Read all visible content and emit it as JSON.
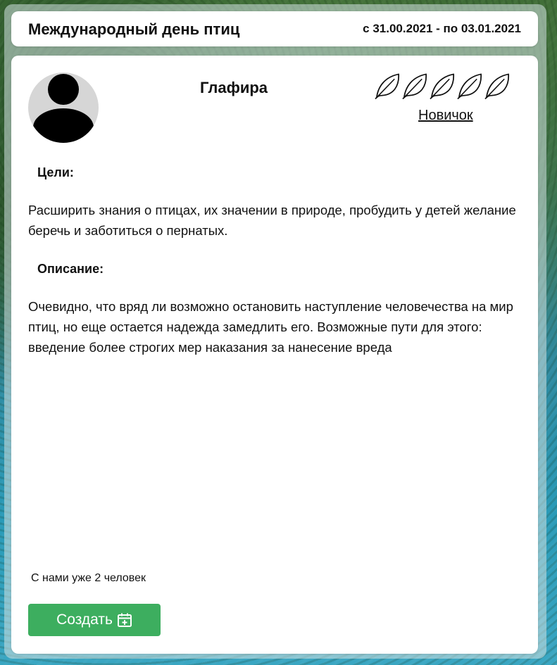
{
  "event": {
    "title": "Международный день птиц",
    "dates": "с 31.00.2021 - по 03.01.2021"
  },
  "user": {
    "avatar_icon": "user-avatar-icon",
    "name": "Глафира",
    "rating_icon": "leaf-icon",
    "rating_max": 5,
    "rating_filled": 0,
    "rank": "Новичок"
  },
  "goals": {
    "label": "Цели:",
    "text": "Расширить знания о птицах, их значении в природе, пробудить у детей желание беречь и заботиться о пернатых."
  },
  "description": {
    "label": "Описание:",
    "text": "Очевидно, что вряд ли возможно остановить наступление человечества на мир птиц, но еще остается надежда замедлить его. Возможные пути для этого: введение более строгих мер наказания за нанесение вреда"
  },
  "footer": {
    "members_text": "С нами уже 2 человек",
    "create_label": "Создать",
    "create_icon": "calendar-plus-icon"
  },
  "colors": {
    "create_button": "#3dae5f",
    "avatar_bg": "#d6d6d6"
  }
}
